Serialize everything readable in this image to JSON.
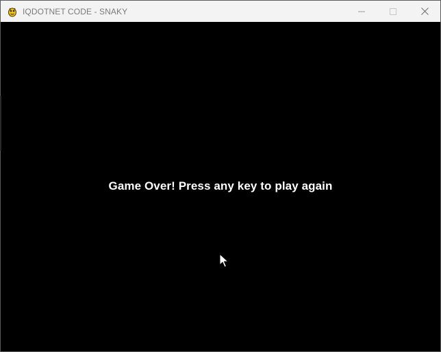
{
  "window": {
    "title": "IQDOTNET CODE - SNAKY",
    "app_icon": "pygame-snake-icon",
    "controls": [
      "minimize-icon",
      "maximize-icon",
      "close-icon"
    ]
  },
  "game": {
    "message": "Game Over! Press any key to play again",
    "background_color": "#000000",
    "text_color": "#ffffff"
  },
  "cursor": {
    "icon": "mouse-pointer-icon"
  }
}
